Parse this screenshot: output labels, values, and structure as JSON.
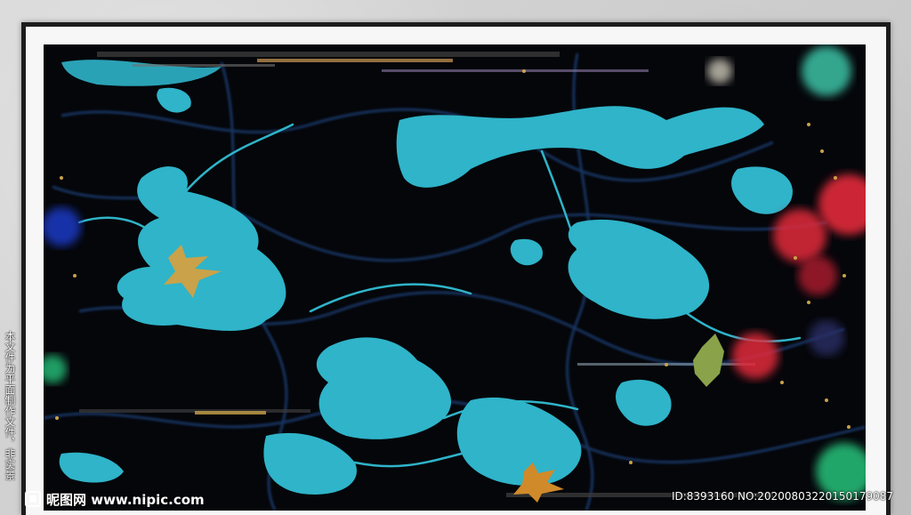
{
  "artwork": {
    "palette": {
      "background": "#05060a",
      "cyan": "#2fb4c9",
      "deep_blue": "#1d3f77",
      "red": "#e2293a",
      "green": "#27c27a",
      "gold": "#c9a24a"
    }
  },
  "side_text": "本文件为平面制作文件，非实景",
  "watermark": {
    "brand": "昵图网 www.nipic.com",
    "id_text": "ID:8393160 NO:20200803220150179087"
  }
}
